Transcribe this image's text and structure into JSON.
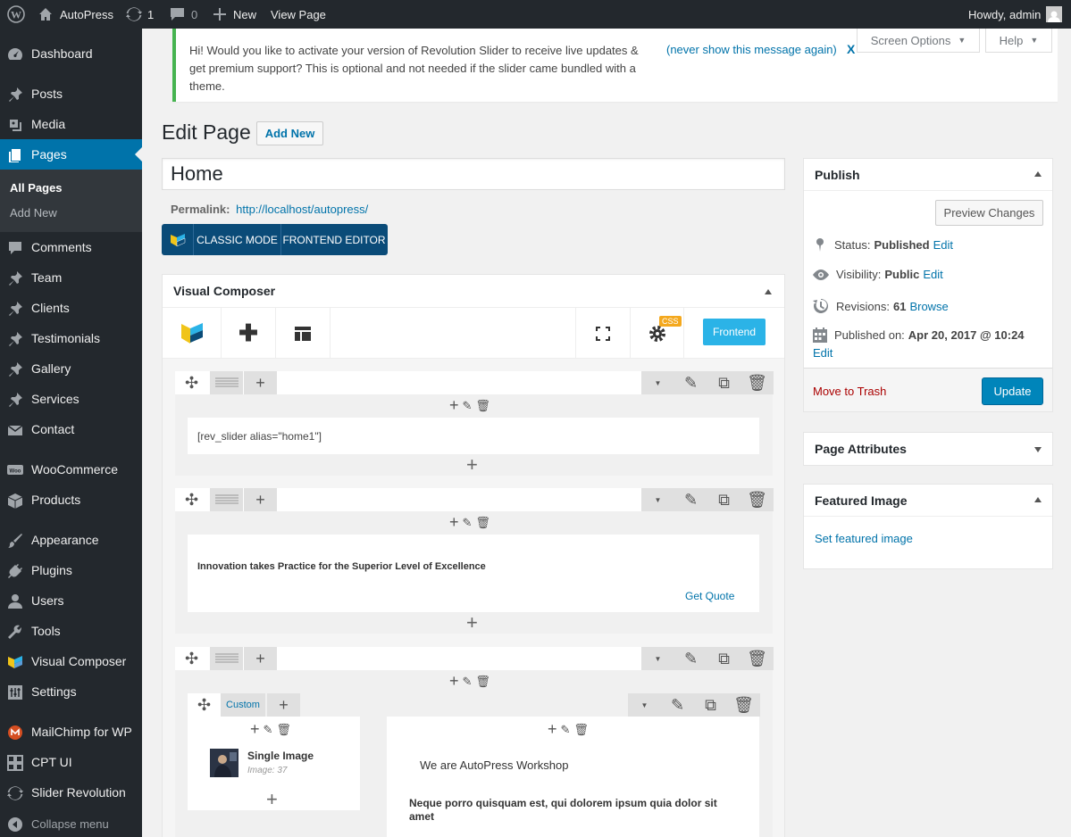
{
  "adminbar": {
    "site_name": "AutoPress",
    "updates_count": "1",
    "comments_count": "0",
    "new_label": "New",
    "view_page_label": "View Page",
    "howdy": "Howdy, admin"
  },
  "menu": {
    "items": [
      {
        "label": "Dashboard",
        "icon": "dashboard-icon"
      },
      {
        "label": "Posts",
        "icon": "pin-icon"
      },
      {
        "label": "Media",
        "icon": "media-icon"
      },
      {
        "label": "Pages",
        "icon": "pages-icon"
      },
      {
        "label": "Comments",
        "icon": "comment-icon"
      },
      {
        "label": "Team",
        "icon": "pin-icon"
      },
      {
        "label": "Clients",
        "icon": "pin-icon"
      },
      {
        "label": "Testimonials",
        "icon": "pin-icon"
      },
      {
        "label": "Gallery",
        "icon": "pin-icon"
      },
      {
        "label": "Services",
        "icon": "pin-icon"
      },
      {
        "label": "Contact",
        "icon": "envelope-icon"
      },
      {
        "label": "WooCommerce",
        "icon": "woocommerce-icon"
      },
      {
        "label": "Products",
        "icon": "box-icon"
      },
      {
        "label": "Appearance",
        "icon": "brush-icon"
      },
      {
        "label": "Plugins",
        "icon": "plug-icon"
      },
      {
        "label": "Users",
        "icon": "user-icon"
      },
      {
        "label": "Tools",
        "icon": "wrench-icon"
      },
      {
        "label": "Visual Composer",
        "icon": "vc-logo-icon"
      },
      {
        "label": "Settings",
        "icon": "settings-icon"
      },
      {
        "label": "MailChimp for WP",
        "icon": "mailchimp-icon"
      },
      {
        "label": "CPT UI",
        "icon": "grid-icon"
      },
      {
        "label": "Slider Revolution",
        "icon": "refresh-icon"
      }
    ],
    "submenu": {
      "all_pages": "All Pages",
      "add_new": "Add New"
    },
    "collapse": "Collapse menu"
  },
  "notice": {
    "text": "Hi! Would you like to activate your version of Revolution Slider to receive live updates & get premium support? This is optional and not needed if the slider came bundled with a theme.",
    "dismiss": "(never show this message again)",
    "close": "X"
  },
  "screen_options": "Screen Options",
  "help": "Help",
  "heading": {
    "title": "Edit Page",
    "add_new": "Add New"
  },
  "post_title": "Home",
  "permalink": {
    "label": "Permalink:",
    "url": "http://localhost/autopress/"
  },
  "vc_switch": {
    "classic": "CLASSIC MODE",
    "frontend": "FRONTEND EDITOR"
  },
  "vc": {
    "title": "Visual Composer",
    "css_badge": "CSS",
    "frontend_button": "Frontend",
    "rows": [
      {
        "content": "[rev_slider alias=\"home1\"]"
      },
      {
        "content": "Innovation takes Practice for the Superior Level of Excellence",
        "link": "Get Quote"
      },
      {
        "column_label": "Custom",
        "image_title": "Single Image",
        "image_sub": "Image: 37",
        "text1": "We are AutoPress Workshop",
        "text2": "Neque porro quisquam est, qui dolorem ipsum quia dolor sit amet"
      }
    ]
  },
  "publish": {
    "title": "Publish",
    "preview": "Preview Changes",
    "status_label": "Status:",
    "status_value": "Published",
    "visibility_label": "Visibility:",
    "visibility_value": "Public",
    "revisions_label": "Revisions:",
    "revisions_value": "61",
    "browse": "Browse",
    "published_label": "Published on:",
    "published_value": "Apr 20, 2017 @ 10:24",
    "edit": "Edit",
    "trash": "Move to Trash",
    "update": "Update"
  },
  "page_attributes": "Page Attributes",
  "featured_image": {
    "title": "Featured Image",
    "link": "Set featured image"
  },
  "colors": {
    "admin_dark": "#23282d",
    "accent": "#0073aa",
    "vc_blue": "#0a4b78",
    "frontend_btn": "#2bb3e7",
    "notice_green": "#46b450"
  }
}
